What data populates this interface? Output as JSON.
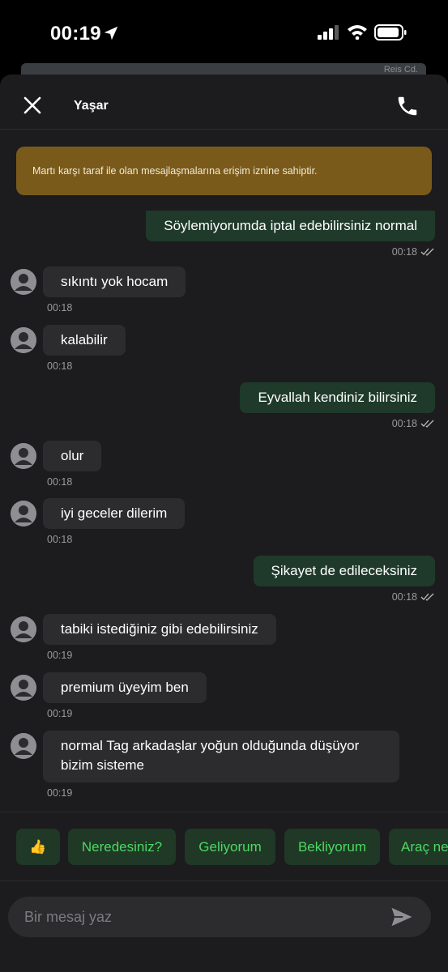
{
  "status_bar": {
    "time": "00:19",
    "icons": [
      "location-arrow-icon",
      "cellular-signal-icon",
      "wifi-icon",
      "battery-icon"
    ]
  },
  "map_peek": {
    "street_label": "Reis Cd."
  },
  "header": {
    "title": "Yaşar",
    "close_icon": "close-icon",
    "call_icon": "phone-icon"
  },
  "notice": {
    "text": "Martı karşı taraf ile olan mesajlaşmalarına erişim iznine sahiptir."
  },
  "messages": [
    {
      "direction": "out",
      "text": "Söylemiyorumda iptal edebilirsiniz normal",
      "time": "00:18",
      "read": true
    },
    {
      "direction": "in",
      "text": "sıkıntı yok hocam",
      "time": "00:18"
    },
    {
      "direction": "in",
      "text": "kalabilir",
      "time": "00:18"
    },
    {
      "direction": "out",
      "text": "Eyvallah kendiniz bilirsiniz",
      "time": "00:18",
      "read": true
    },
    {
      "direction": "in",
      "text": "olur",
      "time": "00:18"
    },
    {
      "direction": "in",
      "text": "iyi geceler dilerim",
      "time": "00:18"
    },
    {
      "direction": "out",
      "text": "Şikayet de edileceksiniz",
      "time": "00:18",
      "read": true
    },
    {
      "direction": "in",
      "text": "tabiki istediğiniz gibi edebilirsiniz",
      "time": "00:19"
    },
    {
      "direction": "in",
      "text": "premium üyeyim ben",
      "time": "00:19"
    },
    {
      "direction": "in",
      "text_line1": "normal Tag arkadaşlar yoğun olduğunda düşüyor",
      "text_line2": "bizim sisteme",
      "time": "00:19"
    }
  ],
  "quick_replies": [
    {
      "label": "👍"
    },
    {
      "label": "Neredesiniz?"
    },
    {
      "label": "Geliyorum"
    },
    {
      "label": "Bekliyorum"
    },
    {
      "label": "Araç ne"
    }
  ],
  "composer": {
    "placeholder": "Bir mesaj yaz",
    "send_icon": "send-icon"
  },
  "colors": {
    "background": "#1c1c1e",
    "outgoing_bubble": "#1f3a2a",
    "incoming_bubble": "#2c2c2e",
    "notice": "#7a5a1a",
    "chip_bg": "#203826",
    "chip_text": "#4cd964"
  }
}
